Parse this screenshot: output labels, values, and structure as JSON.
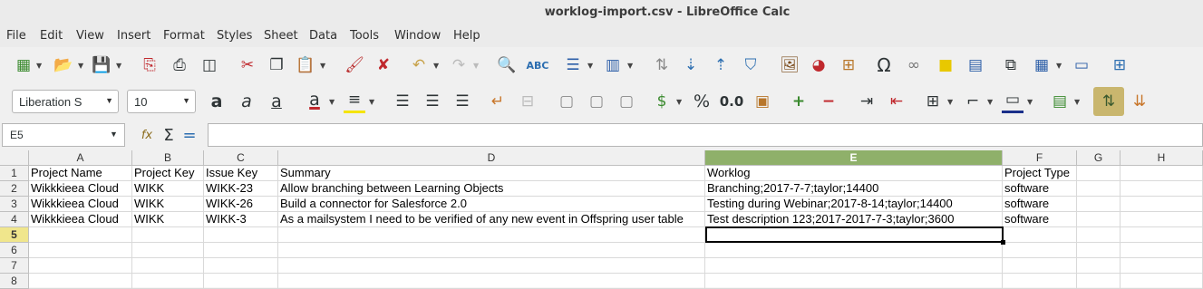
{
  "window": {
    "title": "worklog-import.csv - LibreOffice Calc"
  },
  "menu": [
    "File",
    "Edit",
    "View",
    "Insert",
    "Format",
    "Styles",
    "Sheet",
    "Data",
    "Tools",
    "Window",
    "Help"
  ],
  "formatting": {
    "font_name": "Liberation S",
    "font_size": "10"
  },
  "formula_bar": {
    "name_box": "E5",
    "formula": ""
  },
  "sheet": {
    "columns": [
      "A",
      "B",
      "C",
      "D",
      "E",
      "F",
      "G",
      "H"
    ],
    "selected_column": "E",
    "rows": [
      "1",
      "2",
      "3",
      "4",
      "5",
      "6",
      "7",
      "8"
    ],
    "selected_row": "5",
    "cells": [
      [
        "Project Name",
        "Project Key",
        "Issue Key",
        "Summary",
        "Worklog",
        "Project Type",
        "",
        ""
      ],
      [
        "Wikkkieea Cloud",
        "WIKK",
        "WIKK-23",
        "Allow branching between Learning Objects",
        "Branching;2017-7-7;taylor;14400",
        "software",
        "",
        ""
      ],
      [
        "Wikkkieea Cloud",
        "WIKK",
        "WIKK-26",
        "Build a connector for Salesforce 2.0",
        "Testing during Webinar;2017-8-14;taylor;14400",
        "software",
        "",
        ""
      ],
      [
        "Wikkkieea Cloud",
        "WIKK",
        "WIKK-3",
        "As a mailsystem I need to be verified of any new event in Offspring user table",
        "Test description 123;2017-2017-7-3;taylor;3600",
        "software",
        "",
        ""
      ],
      [
        "",
        "",
        "",
        "",
        "",
        "",
        "",
        ""
      ],
      [
        "",
        "",
        "",
        "",
        "",
        "",
        "",
        ""
      ],
      [
        "",
        "",
        "",
        "",
        "",
        "",
        "",
        ""
      ],
      [
        "",
        "",
        "",
        "",
        "",
        "",
        "",
        ""
      ]
    ]
  }
}
